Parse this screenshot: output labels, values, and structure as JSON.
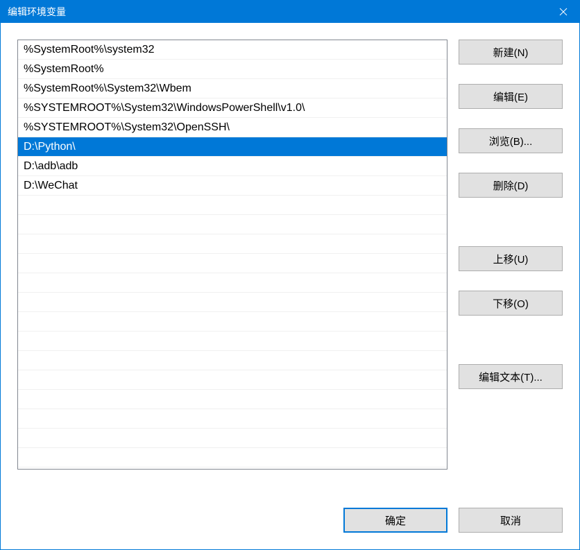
{
  "titlebar": {
    "title": "编辑环境变量"
  },
  "list": {
    "items": [
      "%SystemRoot%\\system32",
      "%SystemRoot%",
      "%SystemRoot%\\System32\\Wbem",
      "%SYSTEMROOT%\\System32\\WindowsPowerShell\\v1.0\\",
      "%SYSTEMROOT%\\System32\\OpenSSH\\",
      "D:\\Python\\",
      "D:\\adb\\adb",
      "D:\\WeChat"
    ],
    "selectedIndex": 5
  },
  "buttons": {
    "new": "新建(N)",
    "edit": "编辑(E)",
    "browse": "浏览(B)...",
    "delete": "删除(D)",
    "moveUp": "上移(U)",
    "moveDown": "下移(O)",
    "editText": "编辑文本(T)...",
    "ok": "确定",
    "cancel": "取消"
  }
}
